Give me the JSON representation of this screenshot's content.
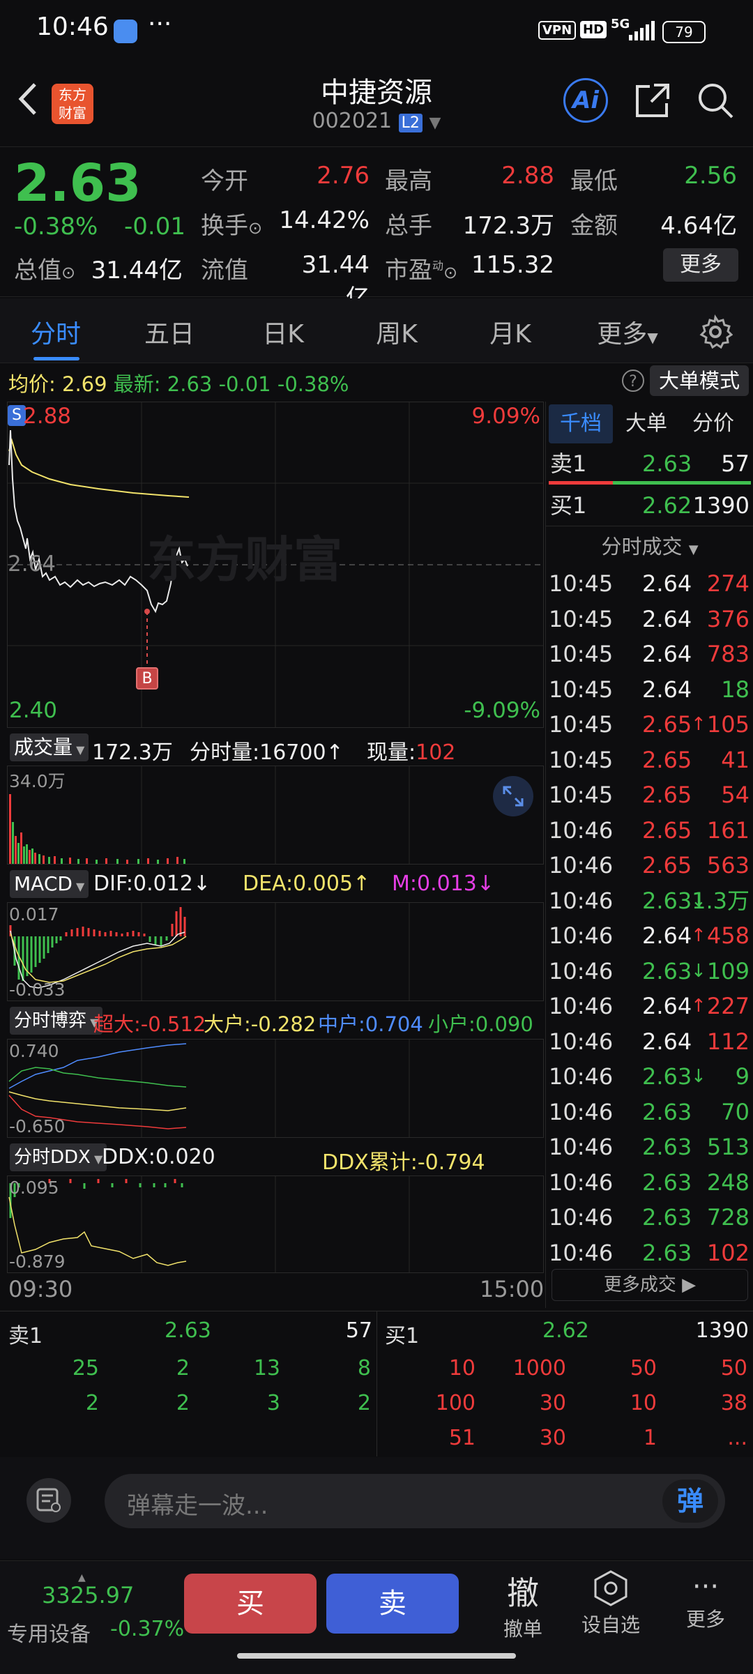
{
  "status": {
    "time": "10:46",
    "vpn": "VPN",
    "hd": "HD",
    "net": "5G",
    "battery": "79"
  },
  "header": {
    "title": "中捷资源",
    "code": "002021",
    "level": "L2",
    "logo_line1": "东方",
    "logo_line2": "财富",
    "ai": "Ai"
  },
  "quote": {
    "price": "2.63",
    "change_pct": "-0.38%",
    "change": "-0.01",
    "open_label": "今开",
    "open": "2.76",
    "high_label": "最高",
    "high": "2.88",
    "low_label": "最低",
    "low": "2.56",
    "turnover_label": "换手",
    "turnover": "14.42%",
    "volume_label": "总手",
    "volume": "172.3万",
    "amount_label": "金额",
    "amount": "4.64亿",
    "mktcap_label": "总值",
    "mktcap": "31.44亿",
    "float_label": "流值",
    "float": "31.44亿",
    "pe_label": "市盈",
    "pe_sup": "动",
    "pe": "115.32",
    "more": "更多"
  },
  "tabs": [
    "分时",
    "五日",
    "日K",
    "周K",
    "月K",
    "更多"
  ],
  "infoline": {
    "avg_label": "均价:",
    "avg": "2.69",
    "latest_label": "最新:",
    "latest": "2.63",
    "chg": "-0.01",
    "chg_pct": "-0.38%",
    "mode": "大单模式"
  },
  "price_chart": {
    "high_price": "2.88",
    "high_pct": "9.09%",
    "mid_price": "2.64",
    "low_price": "2.40",
    "low_pct": "-9.09%",
    "watermark": "东方财富",
    "s_badge": "S",
    "b_badge": "B"
  },
  "volume_panel": {
    "label": "成交量",
    "total": "172.3万",
    "split_label": "分时量:",
    "split": "16700",
    "now_label": "现量:",
    "now": "102",
    "axis_max": "34.0万"
  },
  "macd_panel": {
    "label": "MACD",
    "dif": "DIF:0.012",
    "dea": "DEA:0.005",
    "m": "M:0.013",
    "top": "0.017",
    "bottom": "-0.033"
  },
  "game_panel": {
    "label": "分时博弈",
    "super": "超大:-0.512",
    "big": "大户:-0.282",
    "mid": "中户:0.704",
    "small": "小户:0.090",
    "top": "0.740",
    "bottom": "-0.650"
  },
  "ddx_panel": {
    "label": "分时DDX",
    "ddx": "DDX:0.020",
    "cum": "DDX累计:-0.794",
    "top": "0.095",
    "bottom": "-0.879"
  },
  "time_axis": {
    "start": "09:30",
    "end": "15:00"
  },
  "right_panel": {
    "tabs": [
      "千档",
      "大单",
      "分价"
    ],
    "sell1": {
      "label": "卖1",
      "price": "2.63",
      "vol": "57"
    },
    "buy1": {
      "label": "买1",
      "price": "2.62",
      "vol": "1390"
    },
    "ticks_title": "分时成交",
    "ticks": [
      {
        "t": "10:45",
        "p": "2.64",
        "pc": "white",
        "v": "274",
        "vc": "red",
        "a": ""
      },
      {
        "t": "10:45",
        "p": "2.64",
        "pc": "white",
        "v": "376",
        "vc": "red",
        "a": ""
      },
      {
        "t": "10:45",
        "p": "2.64",
        "pc": "white",
        "v": "783",
        "vc": "red",
        "a": ""
      },
      {
        "t": "10:45",
        "p": "2.64",
        "pc": "white",
        "v": "18",
        "vc": "green",
        "a": ""
      },
      {
        "t": "10:45",
        "p": "2.65",
        "pc": "red",
        "v": "105",
        "vc": "red",
        "a": "↑"
      },
      {
        "t": "10:45",
        "p": "2.65",
        "pc": "red",
        "v": "41",
        "vc": "red",
        "a": ""
      },
      {
        "t": "10:45",
        "p": "2.65",
        "pc": "red",
        "v": "54",
        "vc": "red",
        "a": ""
      },
      {
        "t": "10:46",
        "p": "2.65",
        "pc": "red",
        "v": "161",
        "vc": "red",
        "a": ""
      },
      {
        "t": "10:46",
        "p": "2.65",
        "pc": "red",
        "v": "563",
        "vc": "red",
        "a": ""
      },
      {
        "t": "10:46",
        "p": "2.63",
        "pc": "green",
        "v": "1.3万",
        "vc": "green",
        "a": "↓"
      },
      {
        "t": "10:46",
        "p": "2.64",
        "pc": "white",
        "v": "458",
        "vc": "red",
        "a": "↑"
      },
      {
        "t": "10:46",
        "p": "2.63",
        "pc": "green",
        "v": "109",
        "vc": "green",
        "a": "↓"
      },
      {
        "t": "10:46",
        "p": "2.64",
        "pc": "white",
        "v": "227",
        "vc": "red",
        "a": "↑"
      },
      {
        "t": "10:46",
        "p": "2.64",
        "pc": "white",
        "v": "112",
        "vc": "red",
        "a": ""
      },
      {
        "t": "10:46",
        "p": "2.63",
        "pc": "green",
        "v": "9",
        "vc": "green",
        "a": "↓"
      },
      {
        "t": "10:46",
        "p": "2.63",
        "pc": "green",
        "v": "70",
        "vc": "green",
        "a": ""
      },
      {
        "t": "10:46",
        "p": "2.63",
        "pc": "green",
        "v": "513",
        "vc": "green",
        "a": ""
      },
      {
        "t": "10:46",
        "p": "2.63",
        "pc": "green",
        "v": "248",
        "vc": "green",
        "a": ""
      },
      {
        "t": "10:46",
        "p": "2.63",
        "pc": "green",
        "v": "728",
        "vc": "green",
        "a": ""
      },
      {
        "t": "10:46",
        "p": "2.63",
        "pc": "green",
        "v": "102",
        "vc": "red",
        "a": ""
      }
    ],
    "more_ticks": "更多成交"
  },
  "orderbook": {
    "sell_label": "卖1",
    "sell_price": "2.63",
    "sell_vol": "57",
    "buy_label": "买1",
    "buy_price": "2.62",
    "buy_vol": "1390",
    "sell_rows": [
      [
        "25",
        "2",
        "13",
        "8"
      ],
      [
        "2",
        "2",
        "3",
        "2"
      ]
    ],
    "buy_rows": [
      [
        "10",
        "1000",
        "50",
        "50"
      ],
      [
        "100",
        "30",
        "10",
        "38"
      ],
      [
        "51",
        "30",
        "1",
        "..."
      ]
    ]
  },
  "comment": {
    "placeholder": "弹幕走一波...",
    "danmu": "弹"
  },
  "bottom": {
    "index": "3325.97",
    "device": "专用设备",
    "index_chg": "-0.37%",
    "buy": "买",
    "sell": "卖",
    "cancel_glyph": "撤",
    "cancel": "撤单",
    "custom": "设自选",
    "more": "更多"
  },
  "colors": {
    "up": "#ef3b3b",
    "down": "#3fbf4f",
    "accent": "#3a8cff",
    "avg_line": "#f2e36b",
    "buy_btn": "#c8454a",
    "sell_btn": "#3f5fd6"
  }
}
